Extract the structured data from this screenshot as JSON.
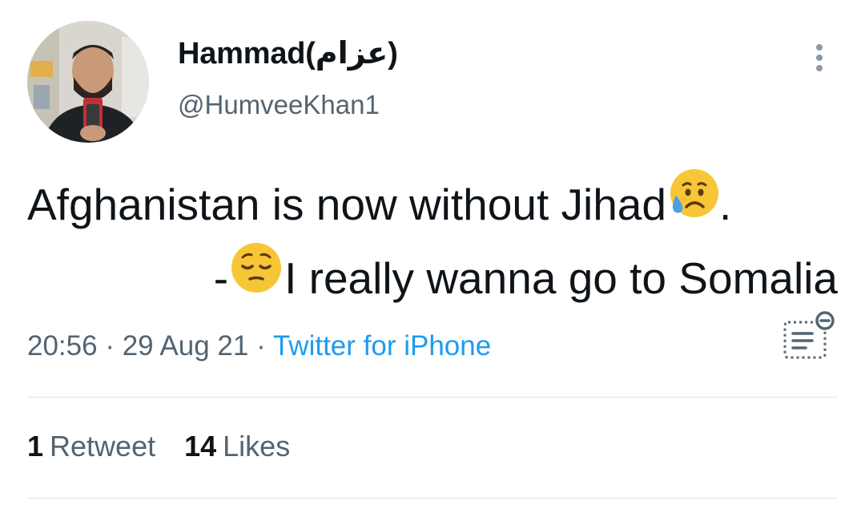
{
  "user": {
    "display_name": "Hammad(عزام)",
    "handle": "@HumveeKhan1"
  },
  "tweet": {
    "line1_text": "Afghanistan is now without Jihad",
    "line1_emoji": "sad-but-relieved-face",
    "line1_end": ".",
    "line2_start": "-",
    "line2_emoji": "pensive-face",
    "line2_text": "I really wanna go to Somalia"
  },
  "meta": {
    "time": "20:56",
    "separator1": " · ",
    "date": "29 Aug 21",
    "separator2": " · ",
    "source": "Twitter for iPhone"
  },
  "stats": {
    "retweets_count": "1",
    "retweets_label": "Retweet",
    "likes_count": "14",
    "likes_label": "Likes"
  },
  "colors": {
    "text": "#0f1419",
    "secondary": "#536471",
    "link": "#1d9bf0",
    "divider": "#dfe3e6"
  }
}
